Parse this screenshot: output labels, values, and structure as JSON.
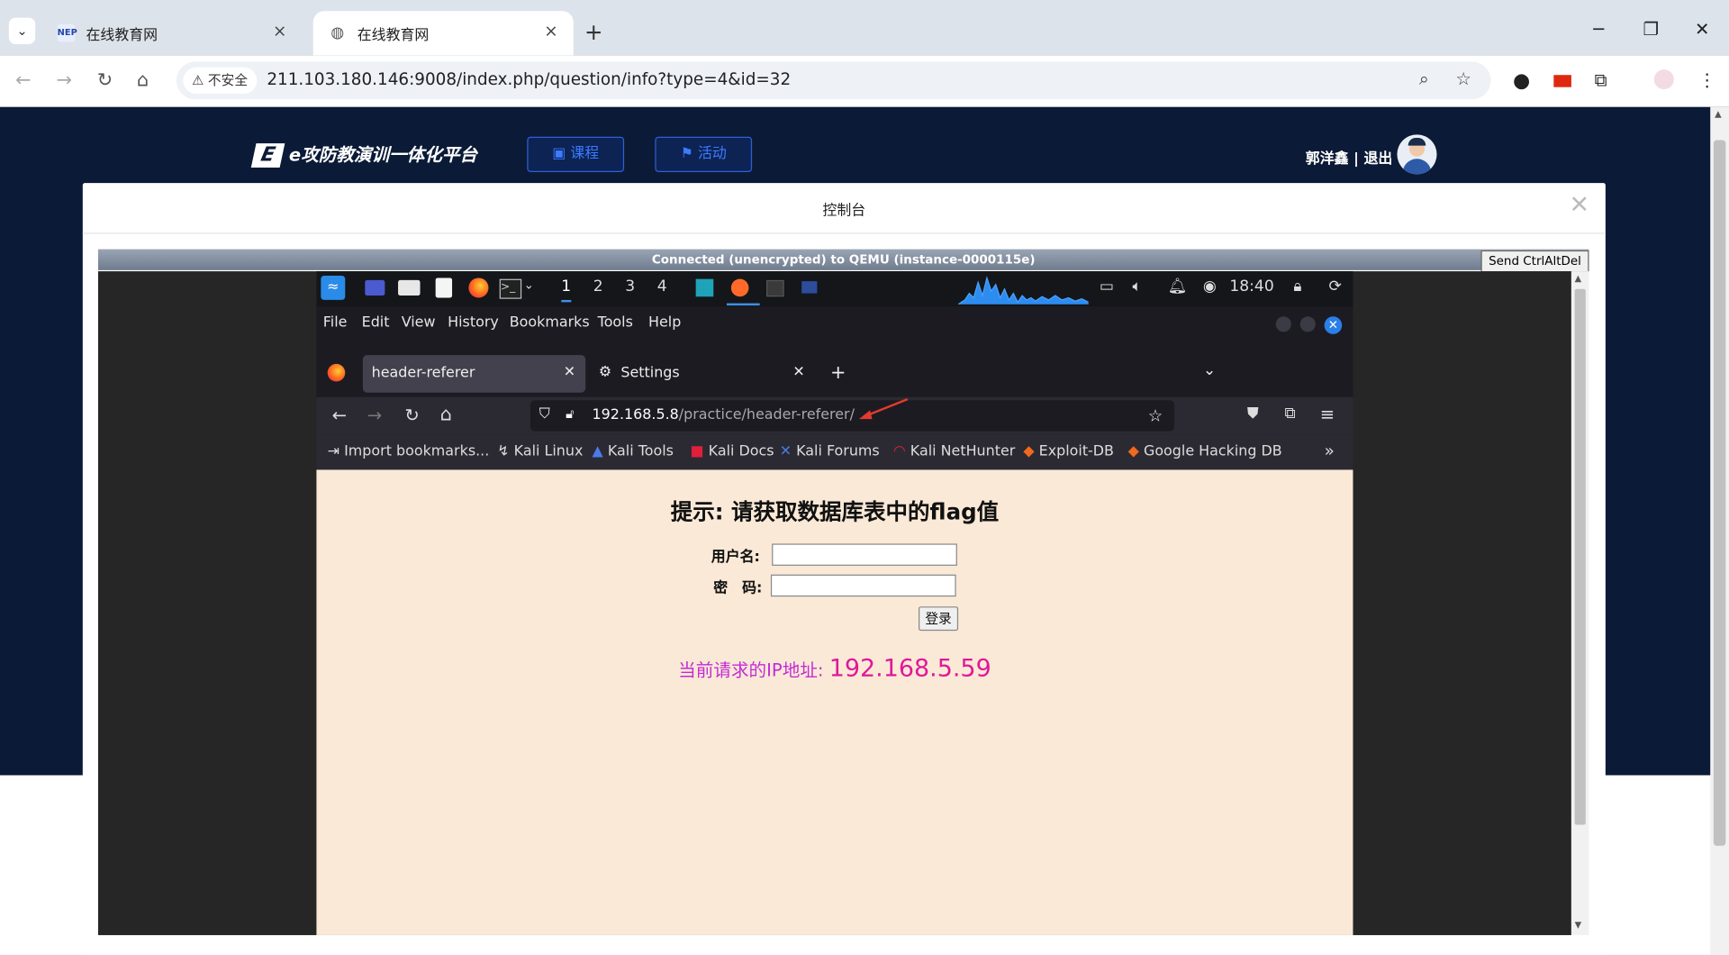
{
  "chrome": {
    "tabs": [
      {
        "title": "在线教育网",
        "favicon": "NEP"
      },
      {
        "title": "在线教育网",
        "favicon": "globe-icon"
      }
    ],
    "security_label": "不安全",
    "url": "211.103.180.146:9008/index.php/question/info?type=4&id=32"
  },
  "site": {
    "platform_name": "e攻防教演训一体化平台",
    "nav": {
      "course": "课程",
      "activity": "活动"
    },
    "user": {
      "name": "郭洋鑫",
      "separator": "|",
      "logout": "退出"
    },
    "modal_title": "控制台"
  },
  "vnc": {
    "status": "Connected (unencrypted) to QEMU (instance-0000115e)",
    "ctrl_alt_del": "Send CtrlAltDel"
  },
  "kali": {
    "workspaces": [
      "1",
      "2",
      "3",
      "4"
    ],
    "clock": "18:40",
    "menu": [
      "File",
      "Edit",
      "View",
      "History",
      "Bookmarks",
      "Tools",
      "Help"
    ],
    "tabs": [
      {
        "title": "header-referer"
      },
      {
        "title": "Settings"
      }
    ],
    "url_host": "192.168.5.8",
    "url_path": "/practice/header-referer/",
    "bookmarks": [
      "Import bookmarks...",
      "Kali Linux",
      "Kali Tools",
      "Kali Docs",
      "Kali Forums",
      "Kali NetHunter",
      "Exploit-DB",
      "Google Hacking DB"
    ]
  },
  "page": {
    "hint": "提示: 请获取数据库表中的flag值",
    "username_label": "用户名:",
    "password_label": "密　码:",
    "login_button": "登录",
    "ip_label": "当前请求的IP地址:",
    "ip_value": "192.168.5.59"
  }
}
